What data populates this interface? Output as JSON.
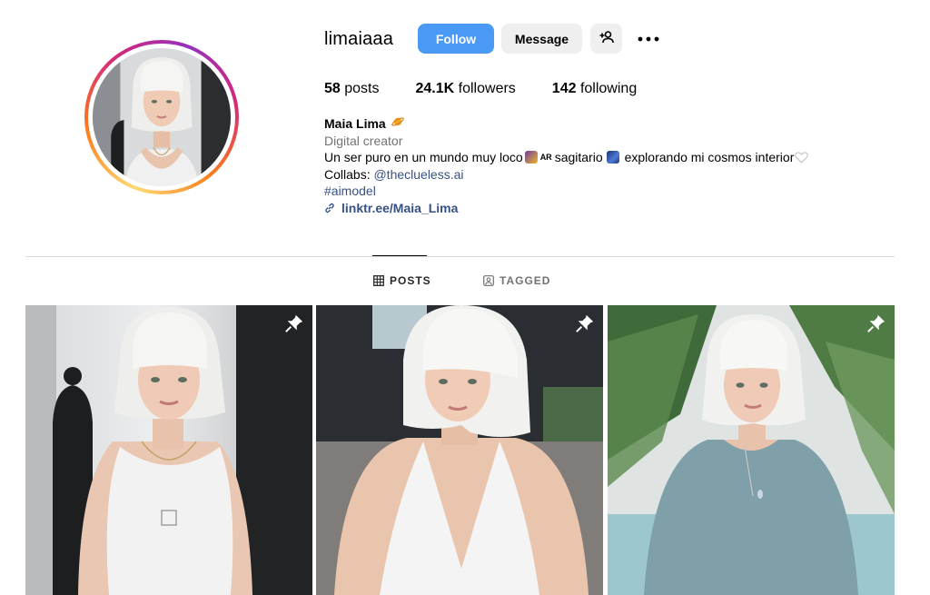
{
  "profile": {
    "username": "limaiaaa",
    "follow_label": "Follow",
    "message_label": "Message",
    "stats": {
      "posts_count": "58",
      "posts_label": "posts",
      "followers_count": "24.1K",
      "followers_label": "followers",
      "following_count": "142",
      "following_label": "following"
    },
    "full_name": "Maia Lima",
    "category": "Digital creator",
    "bio": {
      "text_1": "Un ser puro en un mundo muy loco",
      "ar_tag": "AR",
      "text_2": "sagitario",
      "text_3": "explorando mi cosmos interior",
      "collabs_prefix": "Collabs: ",
      "collabs_handle": "@theclueless.ai",
      "hashtag": "#aimodel",
      "link": "linktr.ee/Maia_Lima"
    }
  },
  "tabs": {
    "posts": "POSTS",
    "tagged": "TAGGED"
  },
  "colors": {
    "follow_button": "#4a9af5",
    "link": "#385185",
    "secondary_text": "#737373"
  },
  "icons": {
    "suggest": "person-add-icon",
    "more": "more-horizontal-icon",
    "pinned": "pin-icon",
    "posts_tab": "grid-icon",
    "tagged_tab": "tagged-icon",
    "link": "link-icon"
  }
}
